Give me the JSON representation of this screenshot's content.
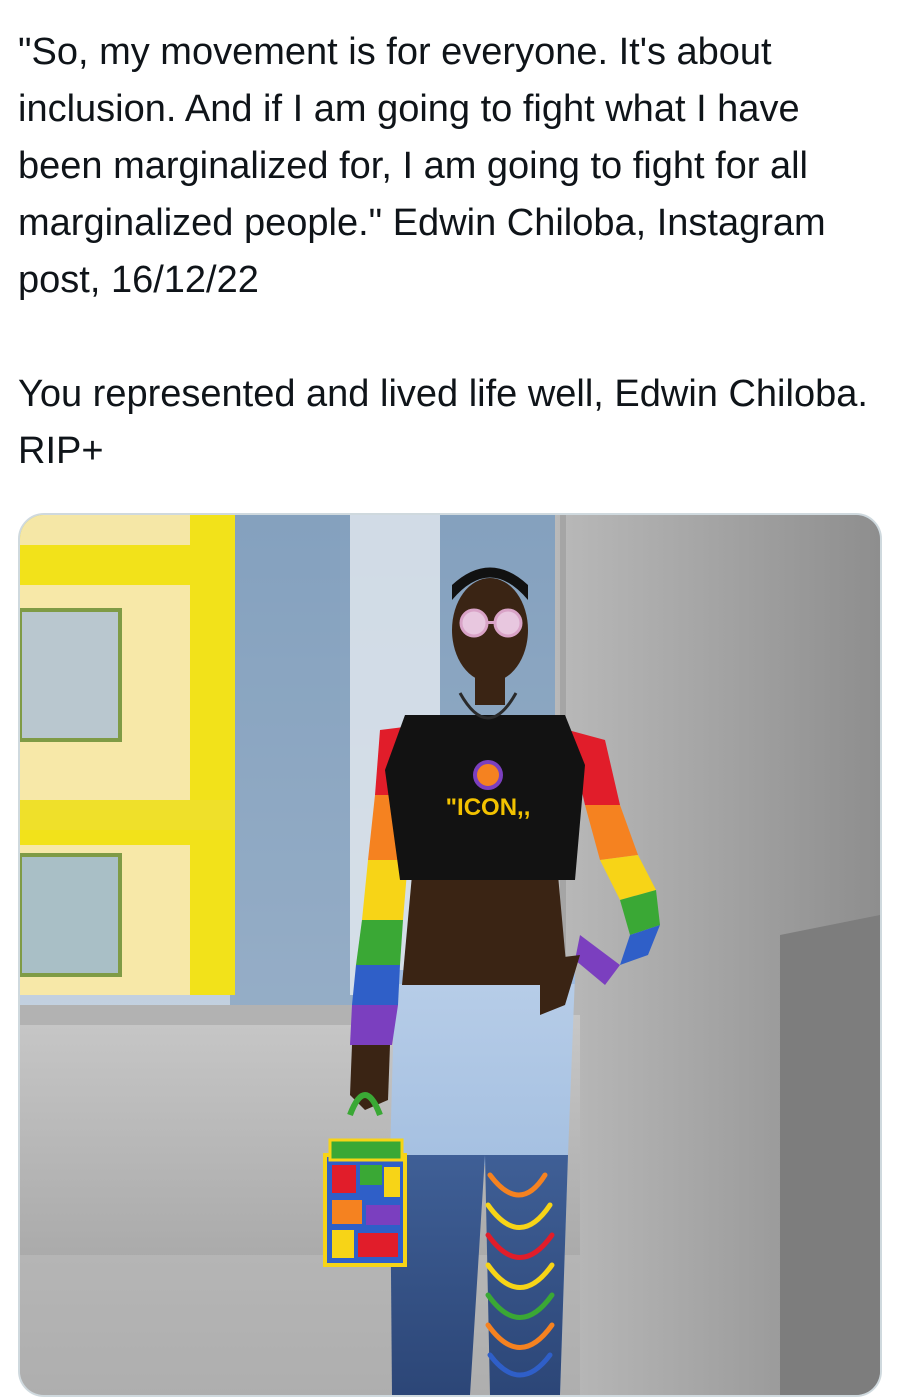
{
  "tweet": {
    "paragraphs": [
      "\"So, my movement is for everyone. It's about inclusion. And if I am going to fight what I have been marginalized for, I am going to fight for all marginalized people.\" Edwin Chiloba, Instagram post, 16/12/22",
      "You represented and lived life well, Edwin Chiloba. RIP+"
    ]
  },
  "photo": {
    "shirt_print": "\"ICON,,",
    "subject": "person in black crop top with rainbow crochet sleeves, jeans with beaded legs, holding a patterned handbag",
    "colors": {
      "rainbow": [
        "#e11d2a",
        "#f58220",
        "#f7d417",
        "#3aa835",
        "#2f5fc8",
        "#7b3fbf"
      ],
      "shirt_text": "#f2c200",
      "building_yellow": "#f2e21a"
    }
  }
}
